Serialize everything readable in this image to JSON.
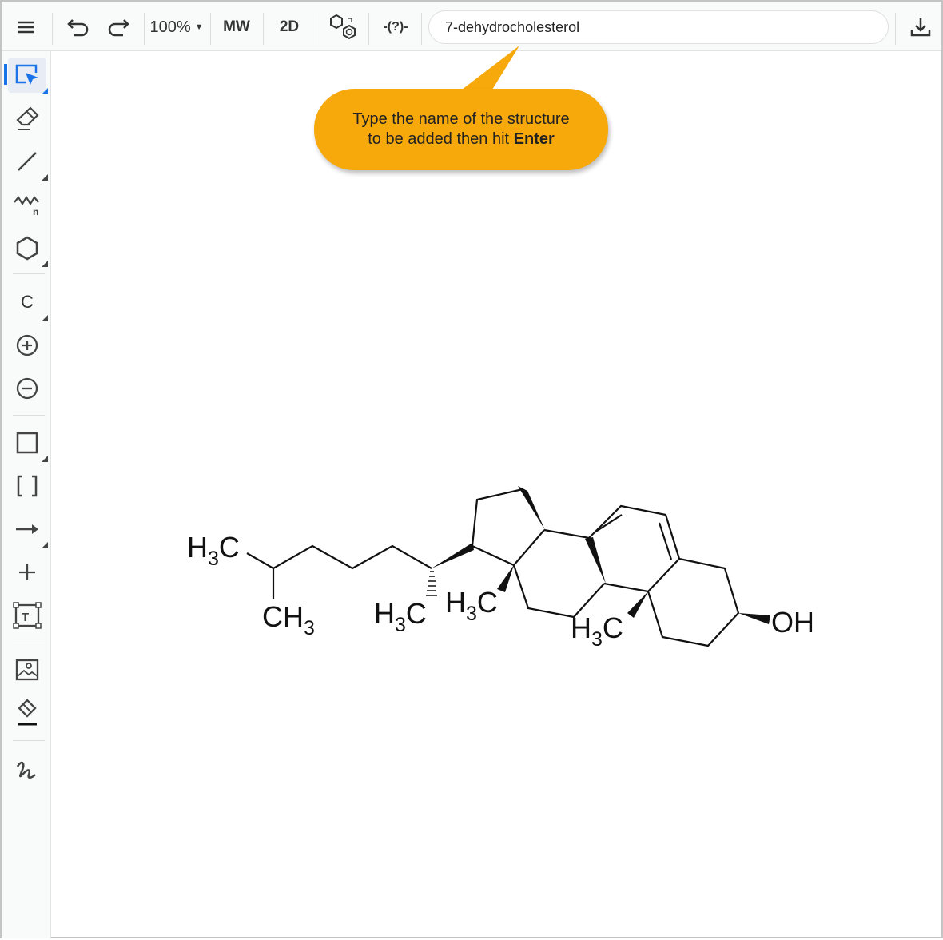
{
  "toolbar": {
    "zoom": "100%",
    "mw": "MW",
    "view2d": "2D",
    "search_value": "7-dehydrocholesterol"
  },
  "tooltip": {
    "line1": "Type the name of the structure",
    "line2_prefix": "to be added then hit ",
    "line2_bold": "Enter"
  },
  "sidebar": {
    "atom_label": "C"
  },
  "molecule": {
    "labels": {
      "h3c_a": "H",
      "h3c_b": "C",
      "sub3": "3",
      "ch3_c": "CH",
      "oh": "OH"
    }
  },
  "colors": {
    "accent": "#1a73e8",
    "tooltip": "#f7a90b"
  }
}
